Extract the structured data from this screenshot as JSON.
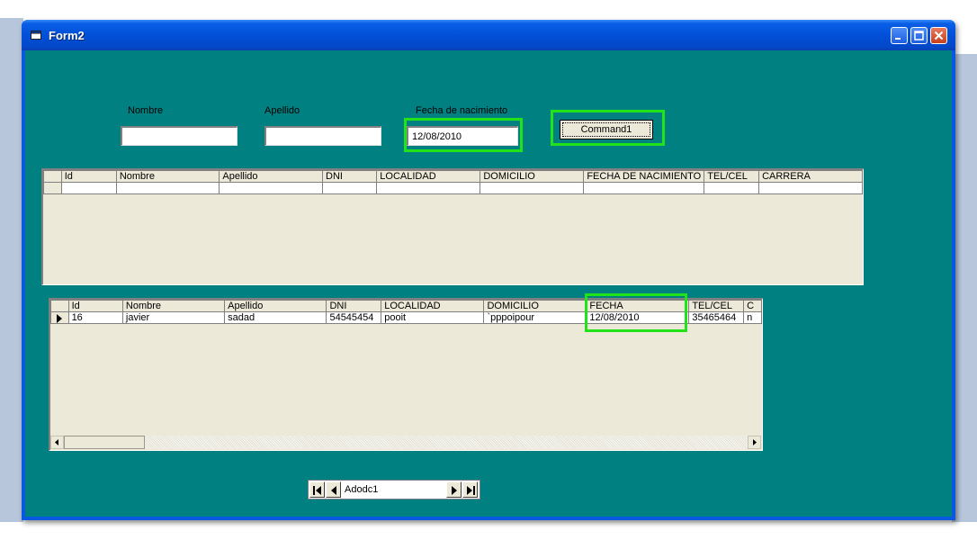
{
  "window": {
    "title": "Form2"
  },
  "form": {
    "nombre_label": "Nombre",
    "apellido_label": "Apellido",
    "fecha_label": "Fecha de nacimiento",
    "nombre_value": "",
    "apellido_value": "",
    "fecha_value": "12/08/2010",
    "command_label": "Command1"
  },
  "grid1": {
    "columns": [
      "Id",
      "Nombre",
      "Apellido",
      "DNI",
      "LOCALIDAD",
      "DOMICILIO",
      "FECHA DE NACIMIENTO",
      "TEL/CEL",
      "CARRERA"
    ],
    "rows": [
      [
        "",
        "",
        "",
        "",
        "",
        "",
        "",
        "",
        ""
      ]
    ]
  },
  "grid2": {
    "columns": [
      "Id",
      "Nombre",
      "Apellido",
      "DNI",
      "LOCALIDAD",
      "DOMICILIO",
      "FECHA",
      "TEL/CEL",
      "C"
    ],
    "rows": [
      [
        "16",
        "javier",
        "sadad",
        "54545454",
        "pooit",
        "`pppoipour",
        "12/08/2010",
        "35465464",
        "n"
      ]
    ]
  },
  "adodc": {
    "caption": "Adodc1"
  },
  "colors": {
    "highlight": "#22e21a",
    "client_bg": "#008080",
    "titlebar": "#0150d8"
  },
  "icons": [
    "form-icon",
    "minimize-icon",
    "maximize-icon",
    "close-icon",
    "record-selector-arrow-icon",
    "scroll-left-icon",
    "scroll-right-icon",
    "first-record-icon",
    "prev-record-icon",
    "next-record-icon",
    "last-record-icon"
  ]
}
